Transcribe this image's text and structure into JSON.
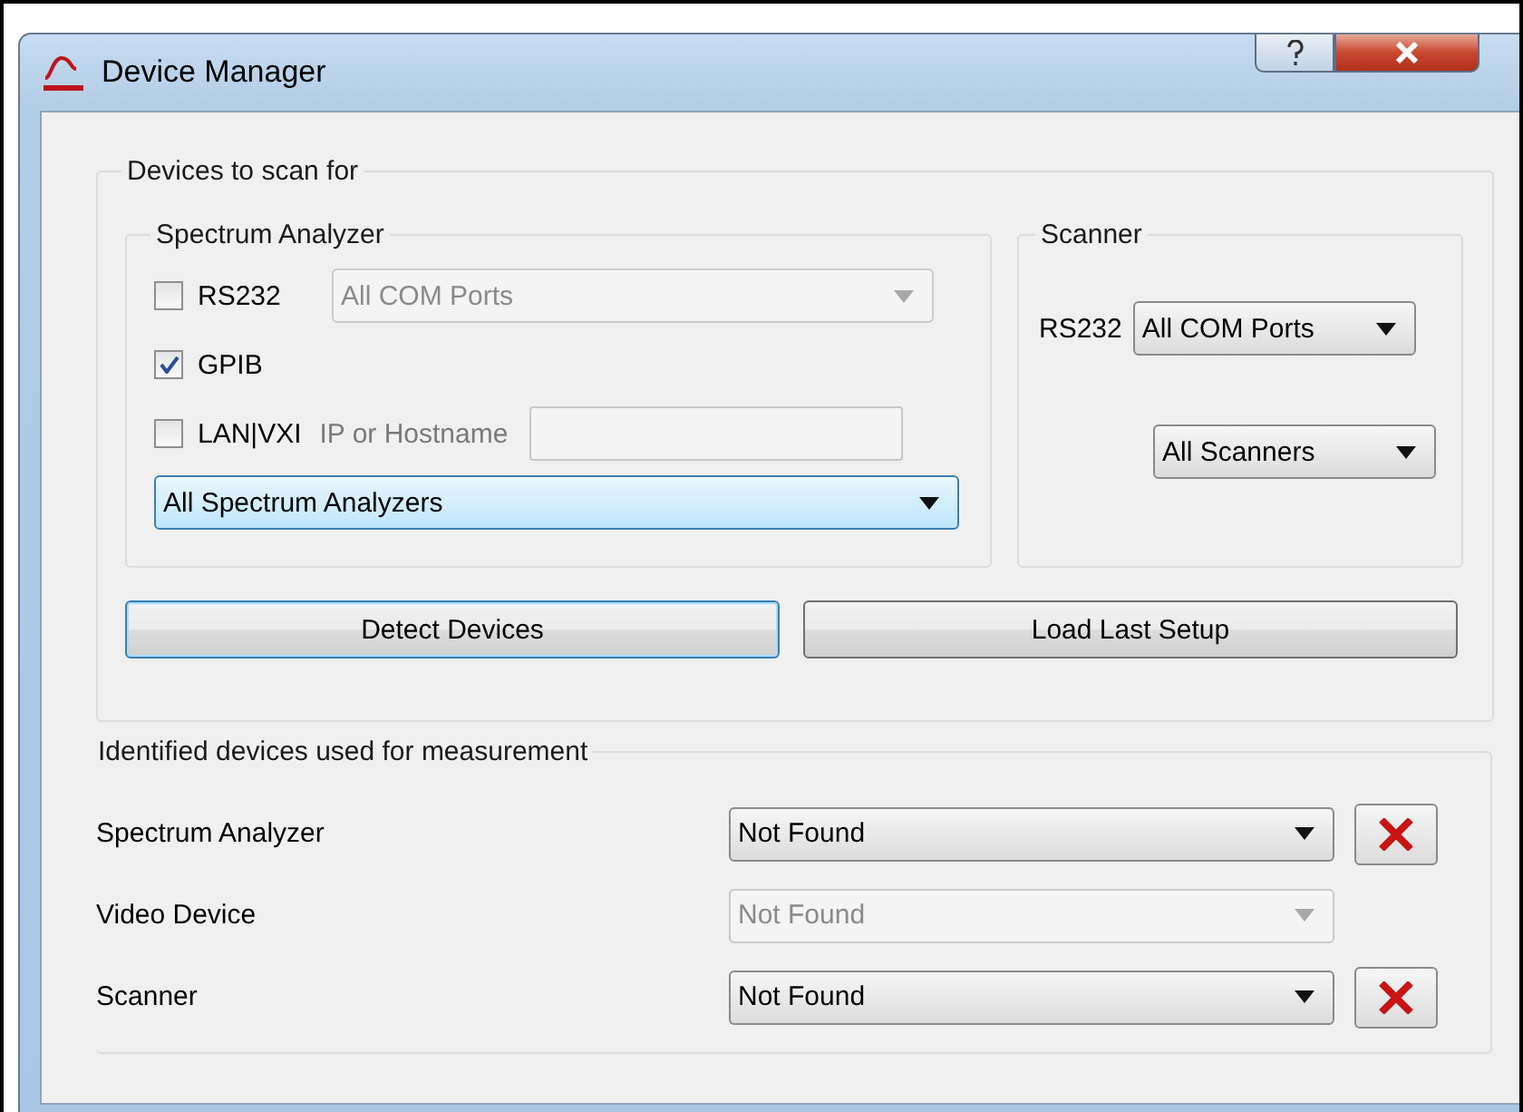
{
  "window": {
    "title": "Device Manager"
  },
  "scan_group": {
    "title": "Devices to scan for",
    "spectrum_analyzer": {
      "title": "Spectrum Analyzer",
      "interfaces": [
        {
          "kind": "combo",
          "label": "RS232",
          "checked": false,
          "value": "All COM Ports",
          "disabled": true
        },
        {
          "kind": "plain",
          "label": "GPIB",
          "checked": true
        },
        {
          "kind": "field",
          "label": "LAN|VXI",
          "checked": false,
          "field_label": "IP or Hostname",
          "disabled": true
        }
      ],
      "type_select": {
        "value": "All Spectrum Analyzers",
        "focused": true
      }
    },
    "scanner": {
      "title": "Scanner",
      "port_label": "RS232",
      "port_value": "All COM Ports",
      "type_value": "All Scanners"
    },
    "buttons": [
      {
        "label": "Detect Devices",
        "focused": true
      },
      {
        "label": "Load Last Setup",
        "focused": false
      }
    ]
  },
  "identified_group": {
    "title": "Identified devices used for measurement",
    "rows": [
      {
        "label": "Spectrum Analyzer",
        "value": "Not Found",
        "disabled": false,
        "kind": "removable"
      },
      {
        "label": "Video Device",
        "value": "Not Found",
        "disabled": true,
        "kind": "fixed"
      },
      {
        "label": "Scanner",
        "value": "Not Found",
        "disabled": false,
        "kind": "removable"
      }
    ]
  }
}
